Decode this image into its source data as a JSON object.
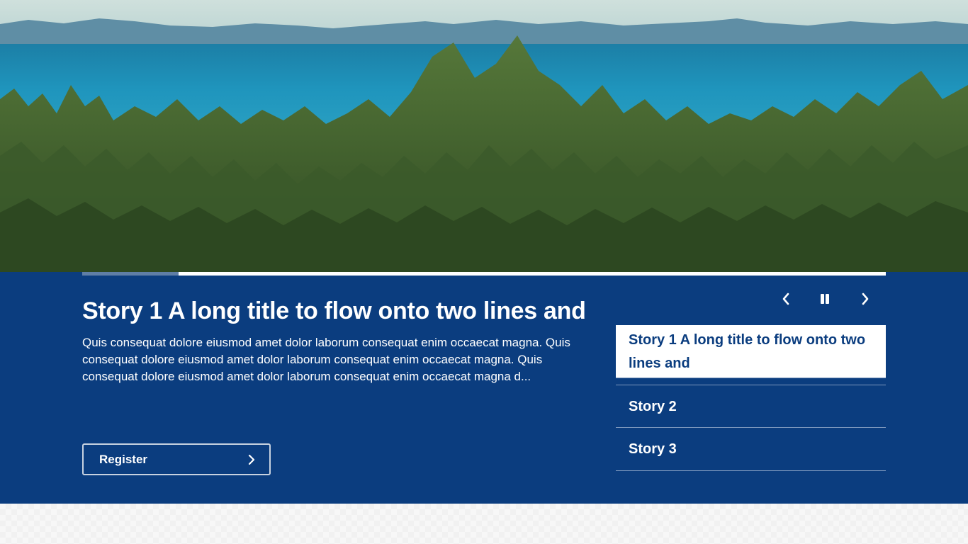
{
  "hero": {
    "image": "forest-and-sea-landscape",
    "colors": {
      "sky": "#c9dcd8",
      "sea": "#1f8fb4",
      "forest": "#4f6f33"
    }
  },
  "progress": {
    "fraction": 0.12
  },
  "story": {
    "title": "Story 1 A long title to flow onto two lines and",
    "description": "Quis consequat dolore eiusmod amet dolor laborum consequat enim occaecat magna. Quis consequat dolore eiusmod amet dolor laborum consequat enim occaecat magna. Quis consequat dolore eiusmod amet dolor laborum consequat enim occaecat magna d...",
    "cta_label": "Register",
    "cta_icon": "chevron-right-icon"
  },
  "controls": {
    "prev_icon": "chevron-left-icon",
    "pause_icon": "pause-icon",
    "next_icon": "chevron-right-icon"
  },
  "stories": [
    {
      "label": "Story 1 A long title to flow onto two lines and",
      "active": true
    },
    {
      "label": "Story 2",
      "active": false
    },
    {
      "label": "Story 3",
      "active": false
    }
  ],
  "colors": {
    "panel": "#0b3d7f",
    "active_text": "#0b3d7f"
  }
}
